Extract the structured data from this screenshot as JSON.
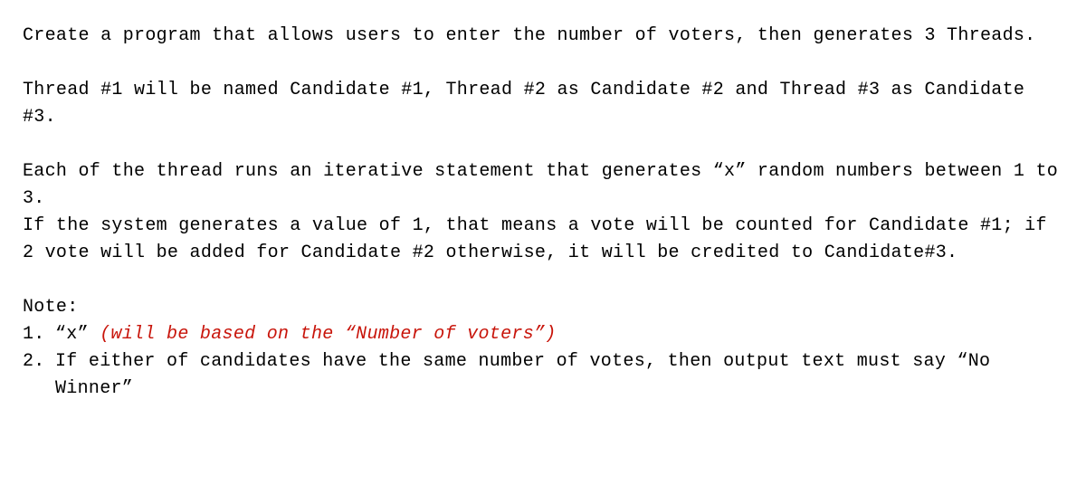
{
  "paragraphs": {
    "intro": "Create a program that allows users to enter the number of voters, then generates 3 Threads.",
    "threads": "Thread #1 will be named Candidate #1, Thread #2 as Candidate #2 and Thread #3 as Candidate #3.",
    "logic_line1": "Each of the thread runs an iterative statement that generates “x” random numbers between 1 to 3.",
    "logic_line2": "If the system generates a value of 1, that means a vote will be counted for Candidate #1; if 2 vote will be added for Candidate #2 otherwise, it will be credited to Candidate#3."
  },
  "note": {
    "heading": "Note:",
    "items": [
      {
        "num": "1.",
        "prefix": "“x” ",
        "emphasis": "(will be based on the “Number of voters”)",
        "suffix": ""
      },
      {
        "num": "2.",
        "prefix": "If either of candidates have the same number of votes, then output text must say “No Winner”",
        "emphasis": "",
        "suffix": ""
      }
    ]
  }
}
